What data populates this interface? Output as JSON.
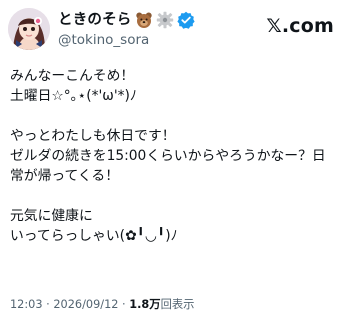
{
  "post": {
    "author": {
      "display_name": "ときのそら",
      "handle": "@tokino_sora",
      "badge_icons": [
        "bear-emoji",
        "gear-emoji",
        "verified-badge-icon"
      ]
    },
    "brand": "𝕏.com",
    "body_lines": [
      "みんなーこんそめ！",
      "土曜日☆°｡⋆(*'ω'*)ﾉ",
      "",
      "やっとわたしも休日です！",
      "ゼルダの続きを15:00くらいからやろうかなー？日",
      "常が帰ってくる！",
      "",
      "元気に健康に",
      "いってらっしゃい(✿╹◡╹)ﾉ"
    ],
    "meta": {
      "time": "12:03",
      "separator": " · ",
      "date": "2026/09/12",
      "views_count": "1.8万",
      "views_label": "回表示"
    }
  },
  "colors": {
    "text": "#0f1419",
    "muted": "#536471",
    "verified": "#1d9bf0"
  }
}
